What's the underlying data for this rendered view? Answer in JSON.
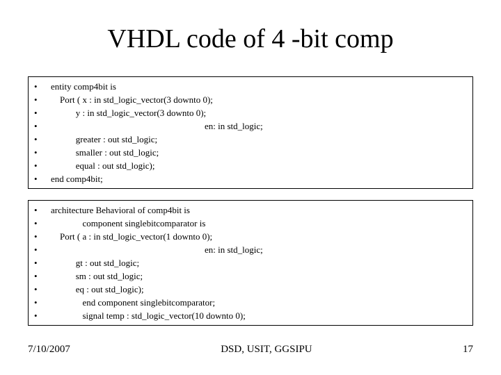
{
  "title": "VHDL code of 4 -bit comp",
  "block1": [
    "entity comp4bit is",
    "    Port ( x : in std_logic_vector(3 downto 0);",
    "           y : in std_logic_vector(3 downto 0);",
    "                                                                    en: in std_logic;",
    "           greater : out std_logic;",
    "           smaller : out std_logic;",
    "           equal : out std_logic);",
    "end comp4bit;"
  ],
  "block2": [
    "architecture Behavioral of comp4bit is",
    "              component singlebitcomparator is",
    "    Port ( a : in std_logic_vector(1 downto 0);",
    "                                                                    en: in std_logic;",
    "           gt : out std_logic;",
    "           sm : out std_logic;",
    "           eq : out std_logic);",
    "              end component singlebitcomparator;",
    "              signal temp : std_logic_vector(10 downto 0);"
  ],
  "footer": {
    "date": "7/10/2007",
    "center": "DSD, USIT, GGSIPU",
    "page": "17"
  }
}
